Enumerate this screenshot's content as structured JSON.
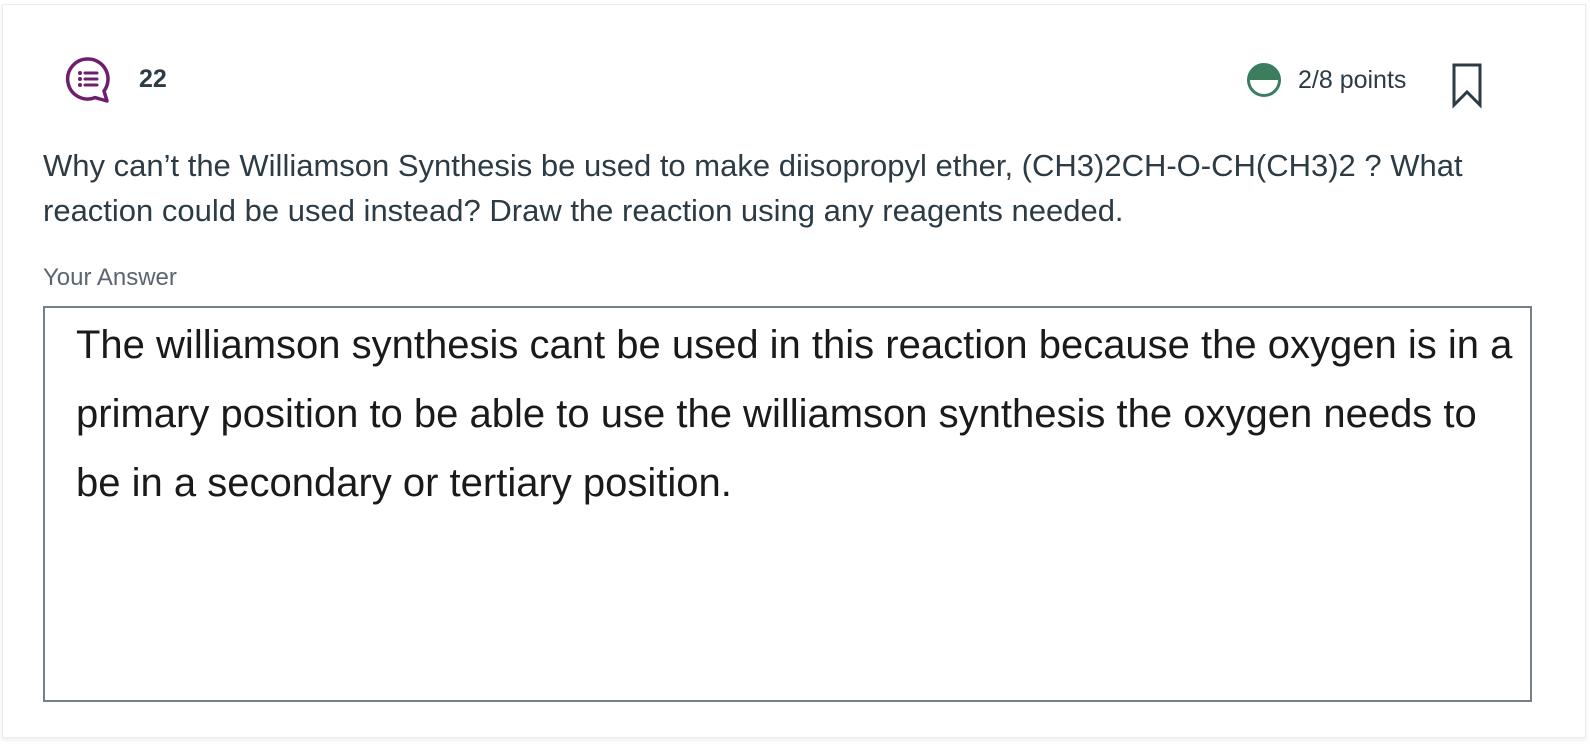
{
  "question": {
    "number": "22",
    "points": "2/8 points",
    "text": "Why can’t the Williamson Synthesis be used to make diisopropyl ether, (CH3)2CH-O-CH(CH3)2 ? What reaction could be used instead? Draw the reaction using any reagents needed."
  },
  "answer": {
    "label": "Your Answer",
    "text": "The williamson synthesis cant be used in this reaction because the oxygen is in a primary position to be able to use the williamson synthesis the oxygen needs to be in a secondary or tertiary position."
  },
  "icons": {
    "question_type": "discussion-list-icon",
    "score": "partial-score-icon",
    "bookmark": "bookmark-icon"
  },
  "colors": {
    "icon_purple": "#6f1d6f",
    "score_green": "#3b7d5e",
    "text_dark": "#2d3b45",
    "border_gray": "#737f8a"
  }
}
